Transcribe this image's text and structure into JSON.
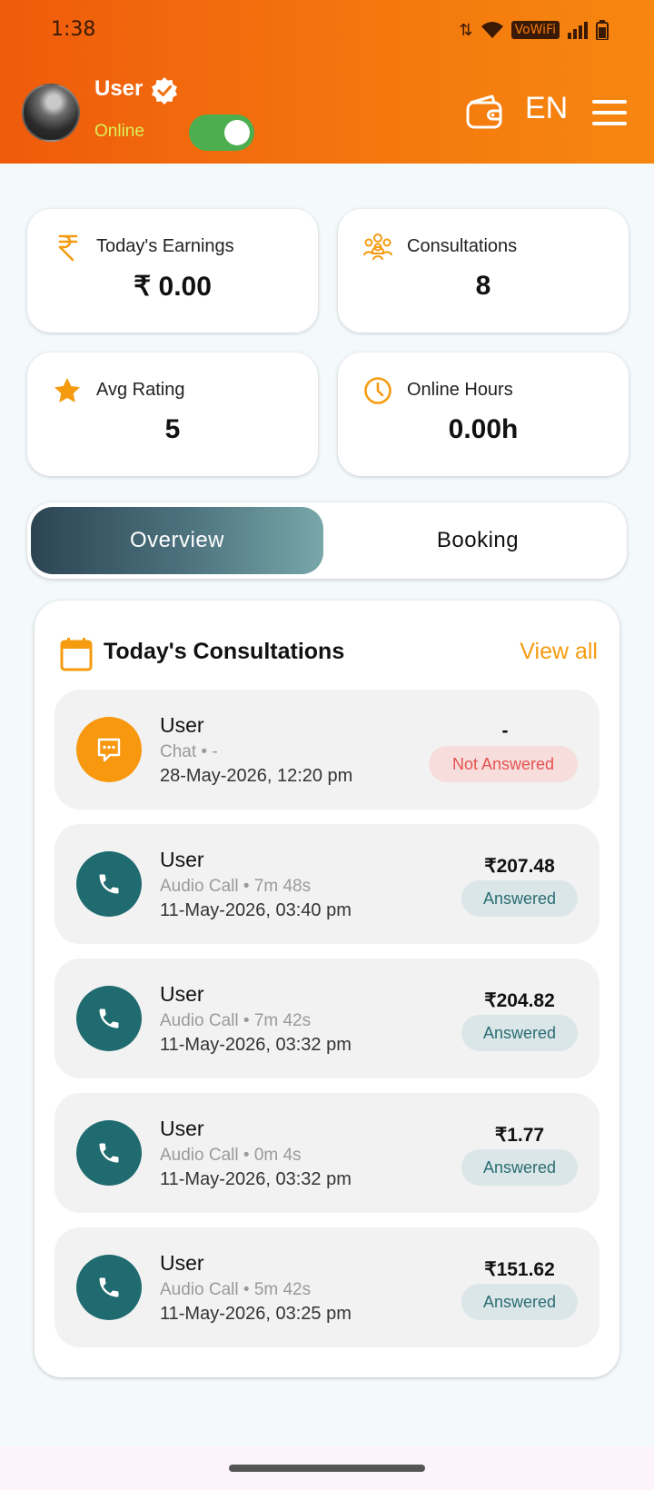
{
  "status_bar": {
    "time": "1:38",
    "vowifi": "VoWiFi"
  },
  "header": {
    "user_name": "User",
    "online_label": "Online",
    "online_toggle": true,
    "language": "EN",
    "colors": {
      "gradient_start": "#ef5b0c",
      "gradient_end": "#f6870f",
      "online_text": "#d9f257",
      "toggle_on": "#4cae4f"
    }
  },
  "stats": [
    {
      "label": "Today's Earnings",
      "value": "₹ 0.00",
      "icon": "rupee-icon"
    },
    {
      "label": "Consultations",
      "value": "8",
      "icon": "group-icon"
    },
    {
      "label": "Avg Rating",
      "value": "5",
      "icon": "star-icon"
    },
    {
      "label": "Online Hours",
      "value": "0.00h",
      "icon": "clock-icon"
    }
  ],
  "tabs": [
    {
      "label": "Overview",
      "active": true
    },
    {
      "label": "Booking",
      "active": false
    }
  ],
  "consultations": {
    "title": "Today's Consultations",
    "view_all": "View all",
    "items": [
      {
        "name": "User",
        "meta": "Chat • -",
        "date": "28-May-2026, 12:20 pm",
        "amount": "-",
        "status": "Not Answered",
        "type": "chat"
      },
      {
        "name": "User",
        "meta": "Audio Call • 7m 48s",
        "date": "11-May-2026, 03:40 pm",
        "amount": "₹207.48",
        "status": "Answered",
        "type": "call"
      },
      {
        "name": "User",
        "meta": "Audio Call • 7m 42s",
        "date": "11-May-2026, 03:32 pm",
        "amount": "₹204.82",
        "status": "Answered",
        "type": "call"
      },
      {
        "name": "User",
        "meta": "Audio Call • 0m 4s",
        "date": "11-May-2026, 03:32 pm",
        "amount": "₹1.77",
        "status": "Answered",
        "type": "call"
      },
      {
        "name": "User",
        "meta": "Audio Call • 5m 42s",
        "date": "11-May-2026, 03:25 pm",
        "amount": "₹151.62",
        "status": "Answered",
        "type": "call"
      }
    ]
  },
  "accent_color": "#f59b10",
  "call_icon_color": "#1f6b70"
}
